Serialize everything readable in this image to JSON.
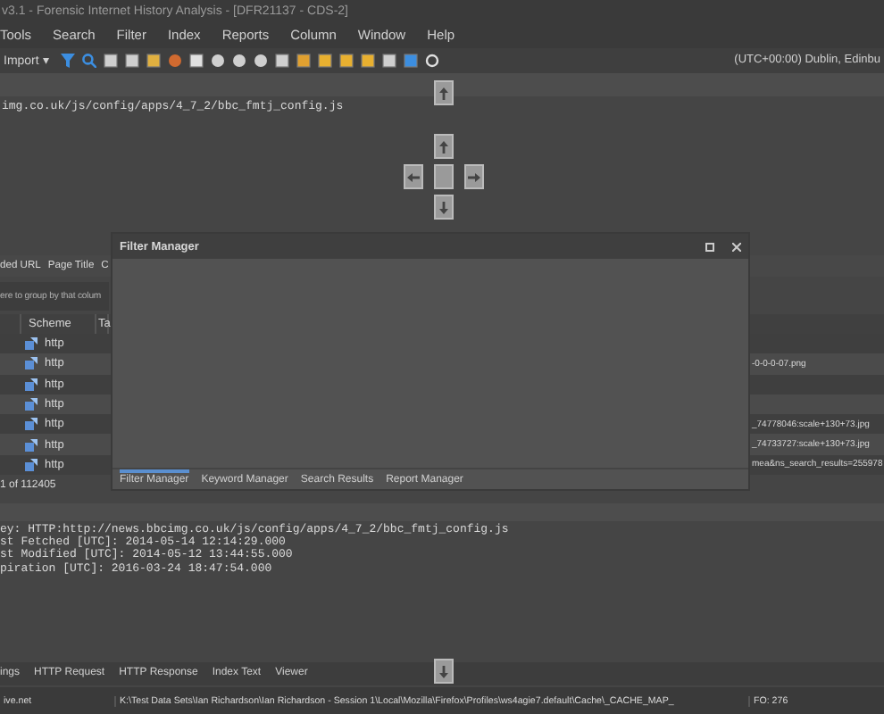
{
  "window": {
    "title": "v3.1 - Forensic Internet History Analysis - [DFR21137 - CDS-2]"
  },
  "menu": [
    "Tools",
    "Search",
    "Filter",
    "Index",
    "Reports",
    "Column",
    "Window",
    "Help"
  ],
  "toolbar": {
    "import": "Import ▾",
    "timezone": "(UTC+00:00) Dublin, Edinbu"
  },
  "address": "img.co.uk/js/config/apps/4_7_2/bbc_fmtj_config.js",
  "grid": {
    "tabs": [
      "ded URL",
      "Page Title",
      "C"
    ],
    "group_hint": "ere to group by that colum",
    "columns": [
      "Scheme",
      "Ta"
    ],
    "rows": [
      {
        "scheme": "http",
        "column_3": ""
      },
      {
        "scheme": "http",
        "column_3": "-0-0-0-07.png"
      },
      {
        "scheme": "http",
        "column_3": ""
      },
      {
        "scheme": "http",
        "column_3": ""
      },
      {
        "scheme": "http",
        "column_3": "_74778046:scale+130+73.jpg"
      },
      {
        "scheme": "http",
        "column_3": "_74733727:scale+130+73.jpg"
      },
      {
        "scheme": "http",
        "column_3": "mea&ns_search_results=255978"
      }
    ],
    "pager": "1 of 112405"
  },
  "filter_window": {
    "title": "Filter Manager",
    "tabs": [
      {
        "label": "Filter Manager",
        "selected": true
      },
      {
        "label": "Keyword Manager",
        "selected": false
      },
      {
        "label": "Search Results",
        "selected": false
      },
      {
        "label": "Report Manager",
        "selected": false
      }
    ]
  },
  "details": [
    "ey: HTTP:http://news.bbcimg.co.uk/js/config/apps/4_7_2/bbc_fmtj_config.js",
    "st Fetched [UTC]: 2014-05-14 12:14:29.000",
    "st Modified [UTC]: 2014-05-12 13:44:55.000",
    "piration [UTC]: 2016-03-24 18:47:54.000"
  ],
  "bottom_tabs": [
    "ings",
    "HTTP Request",
    "HTTP Response",
    "Index Text",
    "Viewer"
  ],
  "status_bar": [
    "ive.net",
    "K:\\Test Data Sets\\Ian Richardson\\Ian Richardson - Session 1\\Local\\Mozilla\\Firefox\\Profiles\\ws4agie7.default\\Cache\\_CACHE_MAP_",
    "FO: 276"
  ]
}
